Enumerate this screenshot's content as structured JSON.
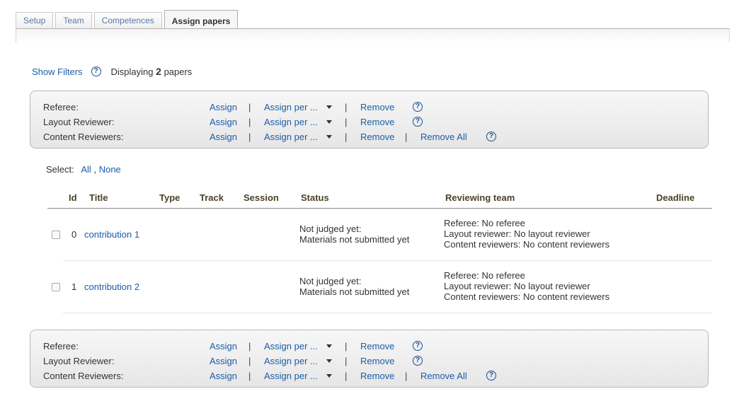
{
  "tabs": [
    {
      "label": "Setup",
      "active": false
    },
    {
      "label": "Team",
      "active": false
    },
    {
      "label": "Competences",
      "active": false
    },
    {
      "label": "Assign papers",
      "active": true
    }
  ],
  "topbar": {
    "show_filters": "Show Filters",
    "displaying_prefix": "Displaying",
    "paper_count": "2",
    "displaying_suffix": "papers"
  },
  "actions": {
    "assign": "Assign",
    "assign_per": "Assign per ...",
    "remove": "Remove",
    "remove_all": "Remove All",
    "separator": "|",
    "help": "?",
    "rows": [
      {
        "label": "Referee:",
        "has_remove_all": false
      },
      {
        "label": "Layout Reviewer:",
        "has_remove_all": false
      },
      {
        "label": "Content Reviewers:",
        "has_remove_all": true
      }
    ]
  },
  "select": {
    "label": "Select:",
    "all": "All",
    "comma": ",",
    "none": "None"
  },
  "table": {
    "columns": {
      "id": "Id",
      "title": "Title",
      "type": "Type",
      "track": "Track",
      "session": "Session",
      "status": "Status",
      "reviewing_team": "Reviewing team",
      "deadline": "Deadline"
    },
    "rows": [
      {
        "id": "0",
        "title": "contribution 1",
        "status_line1": "Not judged yet:",
        "status_line2": "Materials not submitted yet",
        "team_referee": "Referee: No referee",
        "team_layout": "Layout reviewer: No layout reviewer",
        "team_content": "Content reviewers: No content reviewers"
      },
      {
        "id": "1",
        "title": "contribution 2",
        "status_line1": "Not judged yet:",
        "status_line2": "Materials not submitted yet",
        "team_referee": "Referee: No referee",
        "team_layout": "Layout reviewer: No layout reviewer",
        "team_content": "Content reviewers: No content reviewers"
      }
    ]
  }
}
